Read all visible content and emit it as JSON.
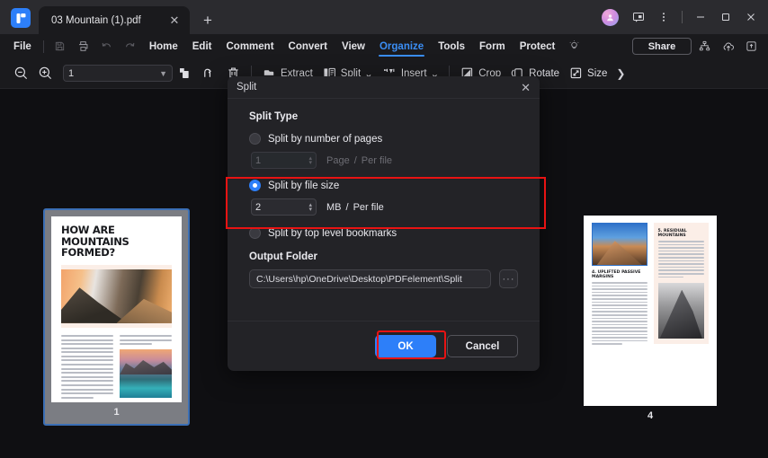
{
  "titlebar": {
    "logo_icon": "wondershare-pdfelement-logo",
    "tab": {
      "title": "03 Mountain (1).pdf",
      "close_icon": "close-icon"
    },
    "new_tab_icon": "plus-icon",
    "avatar_icon": "user-avatar",
    "feedback_icon": "feedback-icon",
    "more_icon": "more-vertical-icon",
    "minimize_icon": "minimize-icon",
    "maximize_icon": "maximize-icon",
    "close_icon": "window-close-icon"
  },
  "menubar": {
    "file_label": "File",
    "quick_icons": [
      {
        "name": "save-icon"
      },
      {
        "name": "print-icon"
      },
      {
        "name": "undo-icon"
      },
      {
        "name": "redo-icon"
      }
    ],
    "items": [
      {
        "label": "Home",
        "active": false
      },
      {
        "label": "Edit",
        "active": false
      },
      {
        "label": "Comment",
        "active": false
      },
      {
        "label": "Convert",
        "active": false
      },
      {
        "label": "View",
        "active": false
      },
      {
        "label": "Organize",
        "active": true
      },
      {
        "label": "Tools",
        "active": false
      },
      {
        "label": "Form",
        "active": false
      },
      {
        "label": "Protect",
        "active": false
      }
    ],
    "bulb_icon": "lightbulb-icon",
    "share_label": "Share",
    "right_icons": [
      {
        "name": "workflow-icon"
      },
      {
        "name": "cloud-upload-icon"
      },
      {
        "name": "collapse-ribbon-icon"
      }
    ]
  },
  "ribbon": {
    "zoom_out_icon": "zoom-out-icon",
    "zoom_in_icon": "zoom-in-icon",
    "page_value": "1",
    "page_caret_icon": "chevron-down-icon",
    "tools": [
      {
        "label": "",
        "icon": "insert-page-icon"
      },
      {
        "label": "",
        "icon": "replace-page-icon"
      },
      {
        "label": "",
        "icon": "delete-page-icon"
      },
      {
        "label": "Extract",
        "icon": "extract-icon"
      },
      {
        "label": "Split",
        "icon": "split-icon",
        "caret": "⌄"
      },
      {
        "label": "Insert",
        "icon": "insert-icon",
        "caret": "⌄"
      },
      {
        "label": "Crop",
        "icon": "crop-icon"
      },
      {
        "label": "Rotate",
        "icon": "rotate-icon"
      },
      {
        "label": "Size",
        "icon": "size-icon"
      }
    ],
    "overflow_label": "❯"
  },
  "thumbnails": [
    {
      "page_number": "1",
      "selected": true,
      "title": "HOW ARE MOUNTAINS FORMED?"
    },
    {
      "page_number": "4",
      "selected": false,
      "heading_left": "4. UPLIFTED PASSIVE MARGINS",
      "heading_right": "5. RESIDUAL MOUNTAINS"
    }
  ],
  "dialog": {
    "title": "Split",
    "close_icon": "close-icon",
    "split_type_label": "Split Type",
    "options": [
      {
        "id": "by-number-of-pages",
        "label": "Split by number of pages",
        "selected": false,
        "value": "1",
        "unit": "Page",
        "separator": "/",
        "per_file": "Per file",
        "disabled": true
      },
      {
        "id": "by-file-size",
        "label": "Split by file size",
        "selected": true,
        "value": "2",
        "unit": "MB",
        "separator": "/",
        "per_file": "Per file",
        "disabled": false
      },
      {
        "id": "by-top-level-bookmarks",
        "label": "Split by top level bookmarks",
        "selected": false
      }
    ],
    "output_folder_label": "Output Folder",
    "output_folder_path": "C:\\Users\\hp\\OneDrive\\Desktop\\PDFelement\\Split",
    "browse_label": "···",
    "ok_label": "OK",
    "cancel_label": "Cancel"
  },
  "annotations": {
    "highlight_color": "#e81313",
    "accent_color": "#2d7ff9",
    "highlights": [
      {
        "target": "split-by-file-size-option"
      },
      {
        "target": "ok-button"
      }
    ]
  }
}
